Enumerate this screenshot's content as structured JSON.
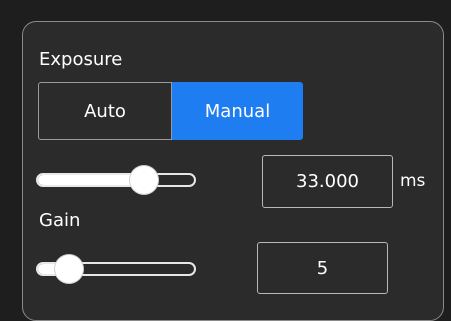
{
  "exposure": {
    "label": "Exposure",
    "modes": {
      "auto": "Auto",
      "manual": "Manual",
      "selected": "Manual"
    },
    "slider_level": 0.68,
    "value": "33.000",
    "unit": "ms"
  },
  "gain": {
    "label": "Gain",
    "slider_level": 0.2,
    "value": "5"
  },
  "colors": {
    "accent": "#1f7df2",
    "panel_background": "#2b2b2b",
    "page_background": "#1e1e1e",
    "border": "#8a8a8a"
  }
}
